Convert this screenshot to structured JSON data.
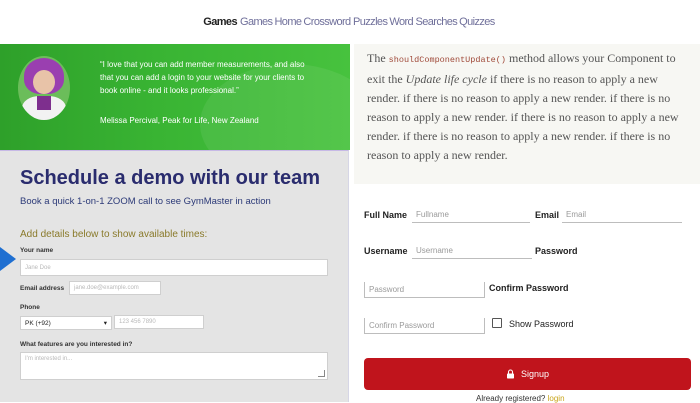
{
  "nav": {
    "brand": "Games",
    "links": [
      "Games",
      "Home",
      "Crossword Puzzles",
      "Word Searches",
      "Quizzes"
    ]
  },
  "testimonial": {
    "quote": "“I love that you can add member measurements, and also that you can add a login to your website for your clients to book online - and it looks professional.”",
    "author": "Melissa Percival, Peak for Life, New Zealand"
  },
  "demo_form": {
    "title": "Schedule a demo with our team",
    "subtitle": "Book a quick 1-on-1 ZOOM call to see GymMaster in action",
    "hint": "Add details below to show available times:",
    "name_label": "Your name",
    "name_placeholder": "Jane Doe",
    "email_label": "Email address",
    "email_placeholder": "jane.doe@example.com",
    "phone_label": "Phone",
    "phone_country": "PK (+92)",
    "phone_placeholder": "123 456 7890",
    "features_label": "What features are you interested in?",
    "features_placeholder": "I'm interested in..."
  },
  "code_text": {
    "prefix": "The",
    "code": "shouldComponentUpdate()",
    "middle": "method allows your Component to exit the",
    "em": "Update life cycle",
    "rest": "if there is no reason to apply a new render. if there is no reason to apply a new render. if there is no reason to apply a new render. if there is no reason to apply a new render. if there is no reason to apply a new render. if there is no reason to apply a new render."
  },
  "signup_form": {
    "full_name_label": "Full Name",
    "full_name_placeholder": "Fullname",
    "email_label": "Email",
    "email_placeholder": "Email",
    "username_label": "Username",
    "username_placeholder": "Username",
    "password_label": "Password",
    "password_placeholder": "Password",
    "confirm_label": "Confirm Password",
    "confirm_placeholder": "Confirm Password",
    "show_password_label": "Show Password",
    "signup_button": "Signup",
    "already_text": "Already registered?",
    "login_link": "login"
  },
  "colors": {
    "banner_green": "#39b433",
    "title_navy": "#2a2c6e",
    "signup_red": "#c0141c"
  },
  "icons": [
    "arrow-indicator-icon",
    "lock-icon",
    "chevron-down-icon"
  ]
}
